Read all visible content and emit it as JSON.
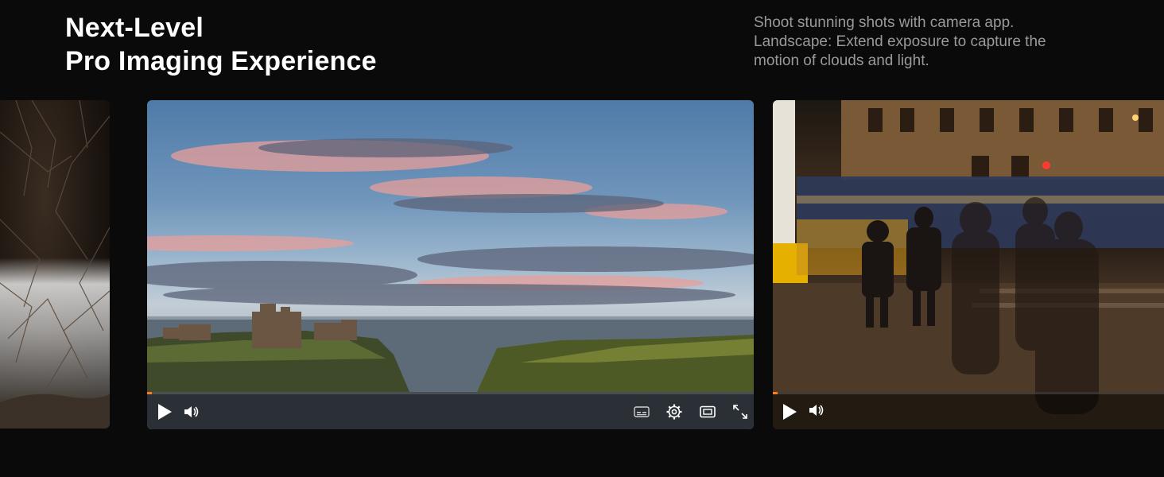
{
  "header": {
    "title_line1": "Next-Level",
    "title_line2": "Pro Imaging Experience"
  },
  "description": {
    "line1": "Shoot stunning shots with camera app.",
    "line2": "Landscape: Extend exposure to capture the",
    "line3": "motion of clouds and light."
  },
  "colors": {
    "background": "#0a0a0a",
    "accent": "#ff7a1a",
    "title": "#ffffff",
    "description": "#9a9a9a"
  },
  "carousel": {
    "slides": [
      {
        "id": "waterfall",
        "visible": "partial-left"
      },
      {
        "id": "coastal-castle",
        "visible": "full",
        "player": {
          "progress": 0.01,
          "controls": [
            "play-icon",
            "volume-icon",
            "subtitles-icon",
            "settings-icon",
            "theater-mode-icon",
            "fullscreen-icon"
          ]
        }
      },
      {
        "id": "city-night",
        "visible": "partial-right",
        "player": {
          "progress": 0.01,
          "controls": [
            "play-icon",
            "volume-icon"
          ]
        }
      }
    ]
  }
}
